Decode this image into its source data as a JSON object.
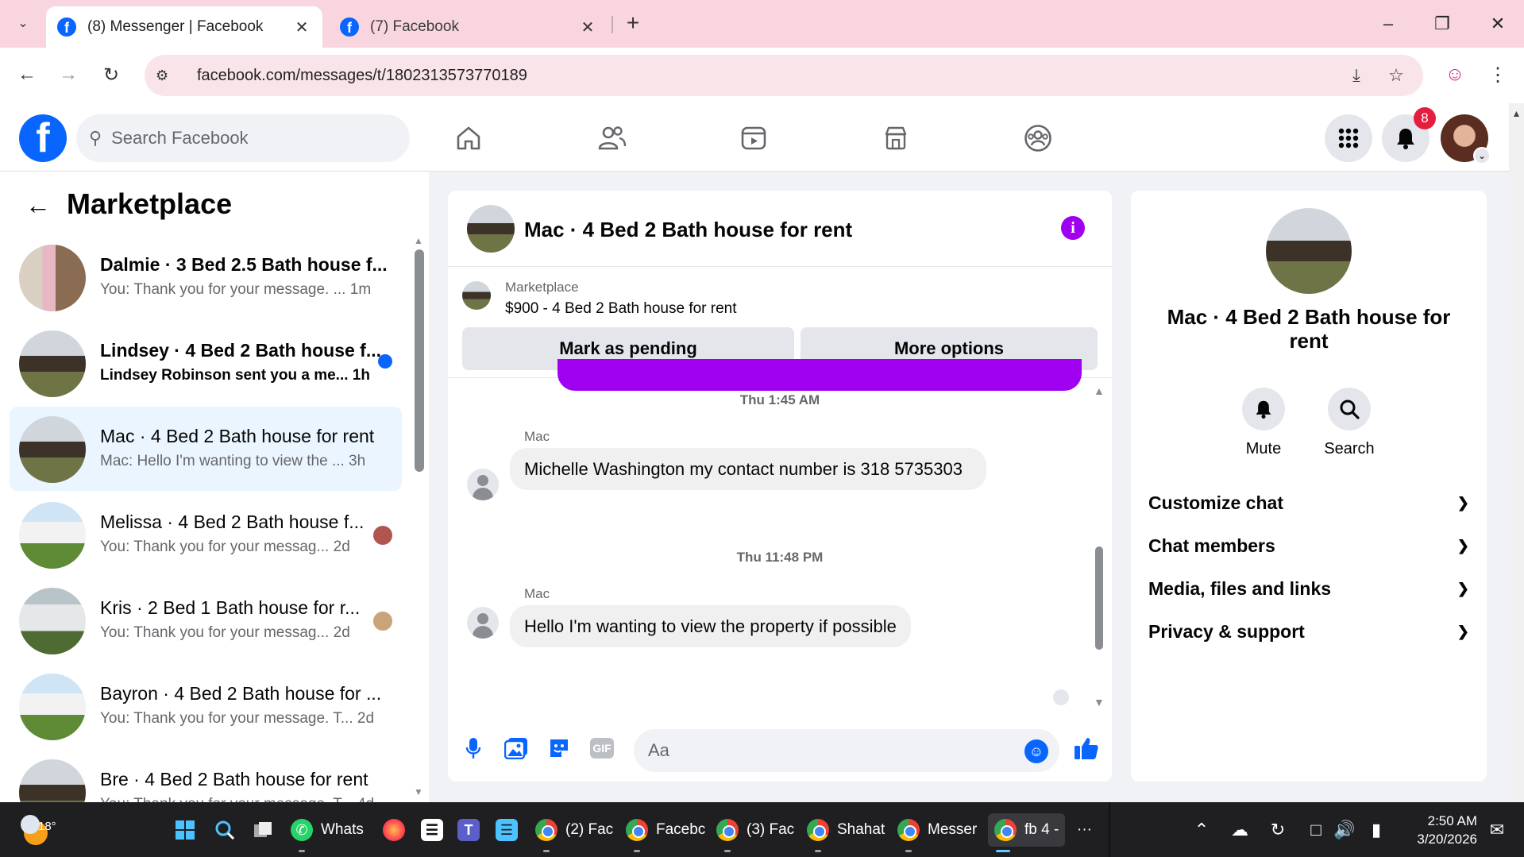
{
  "browser": {
    "tabs": [
      {
        "title": "(8) Messenger | Facebook",
        "active": true
      },
      {
        "title": "(7) Facebook",
        "active": false
      }
    ],
    "url": "facebook.com/messages/t/1802313573770189"
  },
  "fb_header": {
    "search_placeholder": "Search Facebook",
    "notification_count": "8",
    "nav_icons": [
      "home-icon",
      "friends-icon",
      "video-icon",
      "marketplace-icon",
      "groups-icon"
    ]
  },
  "left_panel": {
    "title": "Marketplace",
    "conversations": [
      {
        "name": "Dalmie · 3 Bed 2.5 Bath house f...",
        "preview": "You: Thank you for your message. ...",
        "time": "1m",
        "unread": false,
        "selected": false,
        "bold_name": true,
        "thumb": "interior"
      },
      {
        "name": "Lindsey · 4 Bed 2 Bath house f...",
        "preview": "Lindsey Robinson sent you a me...",
        "time": "1h",
        "unread": true,
        "selected": false,
        "bold_name": true,
        "thumb": "brick"
      },
      {
        "name": "Mac · 4 Bed 2 Bath house for rent",
        "preview": "Mac: Hello I'm wanting to view the ...",
        "time": "3h",
        "unread": false,
        "selected": true,
        "bold_name": false,
        "thumb": "brick"
      },
      {
        "name": "Melissa · 4 Bed 2 Bath house f...",
        "preview": "You: Thank you for your messag...",
        "time": "2d",
        "unread": false,
        "selected": false,
        "bold_name": false,
        "thumb": "white"
      },
      {
        "name": "Kris · 2 Bed 1 Bath house for r...",
        "preview": "You: Thank you for your messag...",
        "time": "2d",
        "unread": false,
        "selected": false,
        "bold_name": false,
        "thumb": "gray"
      },
      {
        "name": "Bayron · 4 Bed 2 Bath house for ...",
        "preview": "You: Thank you for your message. T...",
        "time": "2d",
        "unread": false,
        "selected": false,
        "bold_name": false,
        "thumb": "white"
      },
      {
        "name": "Bre · 4 Bed 2 Bath house for rent",
        "preview": "You: Thank you for your message. T...",
        "time": "4d",
        "unread": false,
        "selected": false,
        "bold_name": false,
        "thumb": "brick"
      }
    ]
  },
  "chat": {
    "title": "Mac · 4 Bed 2 Bath house for rent",
    "listing_source": "Marketplace",
    "listing_price_title": "$900 - 4 Bed 2 Bath house for rent",
    "buttons": {
      "pending": "Mark as pending",
      "more": "More options"
    },
    "messages": [
      {
        "timestamp": "Thu 1:45 AM",
        "sender": "Mac",
        "text": "Michelle Washington my contact number is 318 5735303"
      },
      {
        "timestamp": "Thu 11:48 PM",
        "sender": "Mac",
        "text": "Hello I'm wanting to view the property if possible"
      }
    ],
    "composer_placeholder": "Aa",
    "gif_label": "GIF"
  },
  "right_panel": {
    "title": "Mac · 4 Bed 2 Bath house for rent",
    "actions": [
      {
        "label": "Mute",
        "icon": "bell-icon"
      },
      {
        "label": "Search",
        "icon": "search-icon"
      }
    ],
    "sections": [
      "Customize chat",
      "Chat members",
      "Media, files and links",
      "Privacy & support"
    ]
  },
  "taskbar": {
    "weather_temp": "18°",
    "apps": [
      "Whats",
      "(2) Fac",
      "Facebc",
      "(3) Fac",
      "Shahat",
      "Messer",
      "fb 4 -"
    ],
    "overflow": "···",
    "time": "2:50 AM",
    "date": "3/20/2026"
  },
  "colors": {
    "fb_blue": "#0866ff",
    "messenger_purple": "#a000f0",
    "tab_pink": "#f9d6df",
    "notification_red": "#e41e3f"
  }
}
